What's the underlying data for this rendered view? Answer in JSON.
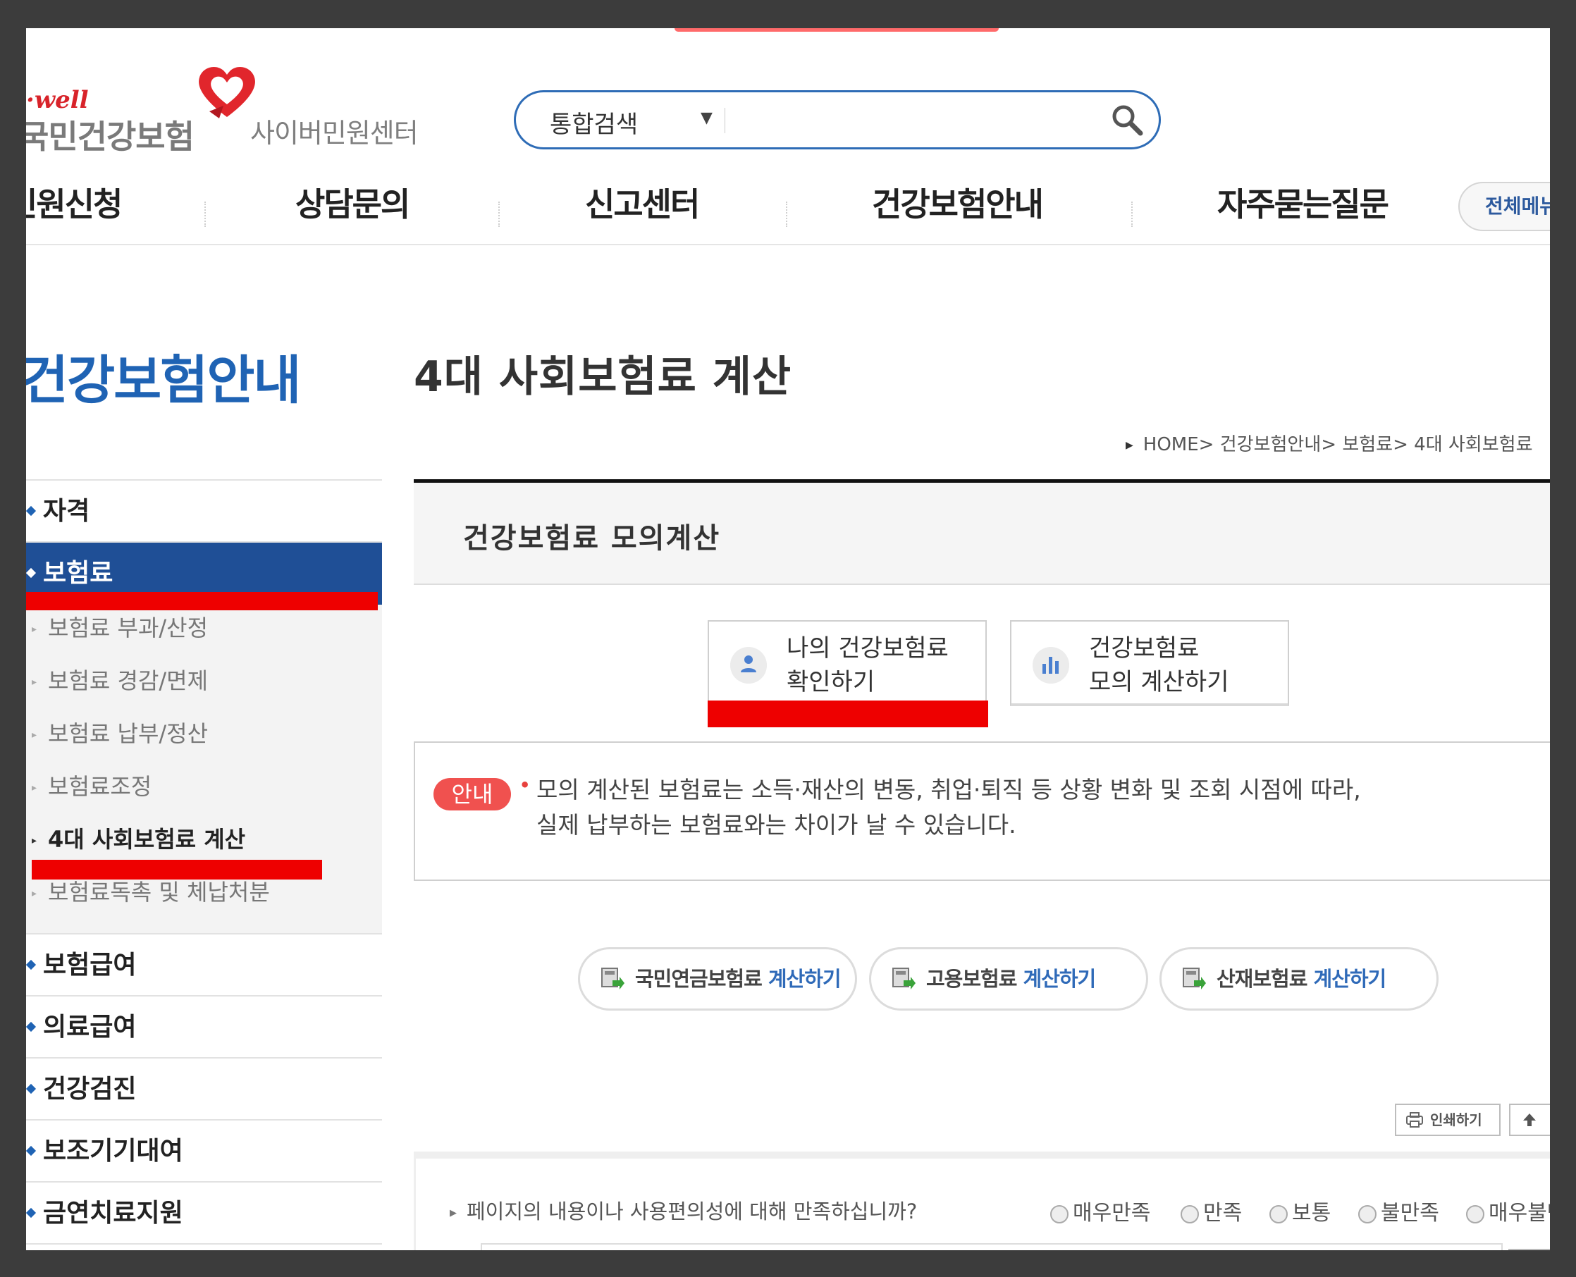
{
  "header": {
    "logo_well": "well",
    "logo_org": "국민건강보험",
    "logo_center": "사이버민원센터",
    "search": {
      "select_label": "통합검색",
      "caret": "▼",
      "value": "",
      "placeholder": ""
    },
    "gnb": [
      "민원신청",
      "상담문의",
      "신고센터",
      "건강보험안내",
      "자주묻는질문"
    ],
    "all_menu_label": "전체메뉴"
  },
  "sidebar": {
    "title": "건강보험안내",
    "menu": [
      {
        "label": "자격"
      },
      {
        "label": "보험료",
        "active": true,
        "sub": [
          {
            "label": "보험료 부과/산정"
          },
          {
            "label": "보험료 경감/면제"
          },
          {
            "label": "보험료 납부/정산"
          },
          {
            "label": "보험료조정"
          },
          {
            "label": "4대 사회보험료 계산",
            "current": true
          },
          {
            "label": "보험료독촉 및 체납처분"
          }
        ]
      },
      {
        "label": "보험급여"
      },
      {
        "label": "의료급여"
      },
      {
        "label": "건강검진"
      },
      {
        "label": "보조기기대여"
      },
      {
        "label": "금연치료지원"
      }
    ]
  },
  "main": {
    "page_title": "4대 사회보험료 계산",
    "breadcrumb": [
      "HOME",
      "건강보험안내",
      "보험료",
      "4대 사회보험료"
    ],
    "breadcrumb_sep": ">",
    "sub_title": "건강보험료 모의계산",
    "tabs": [
      {
        "line1": "나의 건강보험료",
        "line2": "확인하기",
        "icon": "person-icon"
      },
      {
        "line1": "건강보험료",
        "line2": "모의 계산하기",
        "icon": "bar-chart-icon"
      }
    ],
    "notice": {
      "badge": "안내",
      "bullet": "•",
      "line1": "모의 계산된 보험료는 소득·재산의 변동, 취업·퇴직 등 상황 변화 및 조회 시점에 따라,",
      "line2": "실제 납부하는 보험료와는 차이가 날 수 있습니다."
    },
    "calc_buttons": [
      {
        "name": "국민연금보험료",
        "action": "계산하기"
      },
      {
        "name": "고용보험료",
        "action": "계산하기"
      },
      {
        "name": "산재보험료",
        "action": "계산하기"
      }
    ],
    "print_label": "인쇄하기",
    "survey": {
      "question": "페이지의 내용이나 사용편의성에 대해 만족하십니까?",
      "options": [
        "매우만족",
        "만족",
        "보통",
        "불만족",
        "매우불만족"
      ]
    }
  },
  "colors": {
    "brand_blue": "#1f63b4",
    "active_menu": "#1f4f96",
    "brand_red": "#d8232a",
    "annotation_red": "#ee0000",
    "notice_badge": "#f0514f"
  }
}
